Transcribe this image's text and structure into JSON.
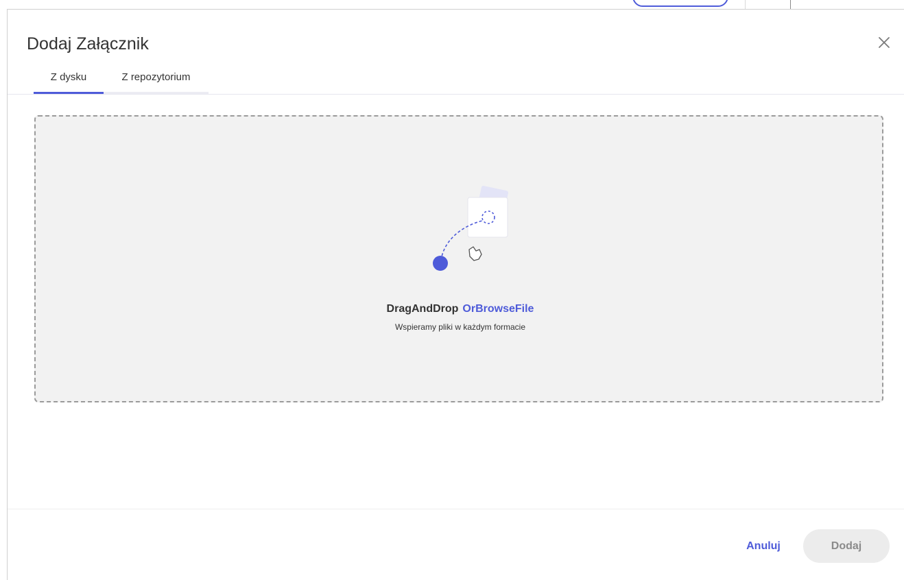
{
  "modal": {
    "title": "Dodaj Załącznik",
    "close_icon": "close-icon"
  },
  "tabs": [
    {
      "label": "Z dysku",
      "active": true
    },
    {
      "label": "Z repozytorium",
      "active": false
    }
  ],
  "dropzone": {
    "primary_text": "DragAndDrop",
    "link_text": "OrBrowseFile",
    "subtitle": "Wspieramy pliki w każdym formacie",
    "illustration_icon": "drag-drop-illustration-icon"
  },
  "footer": {
    "cancel_label": "Anuluj",
    "add_label": "Dodaj"
  },
  "colors": {
    "accent": "#4e5bd9",
    "dropzone_bg": "#f2f2f2",
    "disabled_bg": "#ececec"
  }
}
